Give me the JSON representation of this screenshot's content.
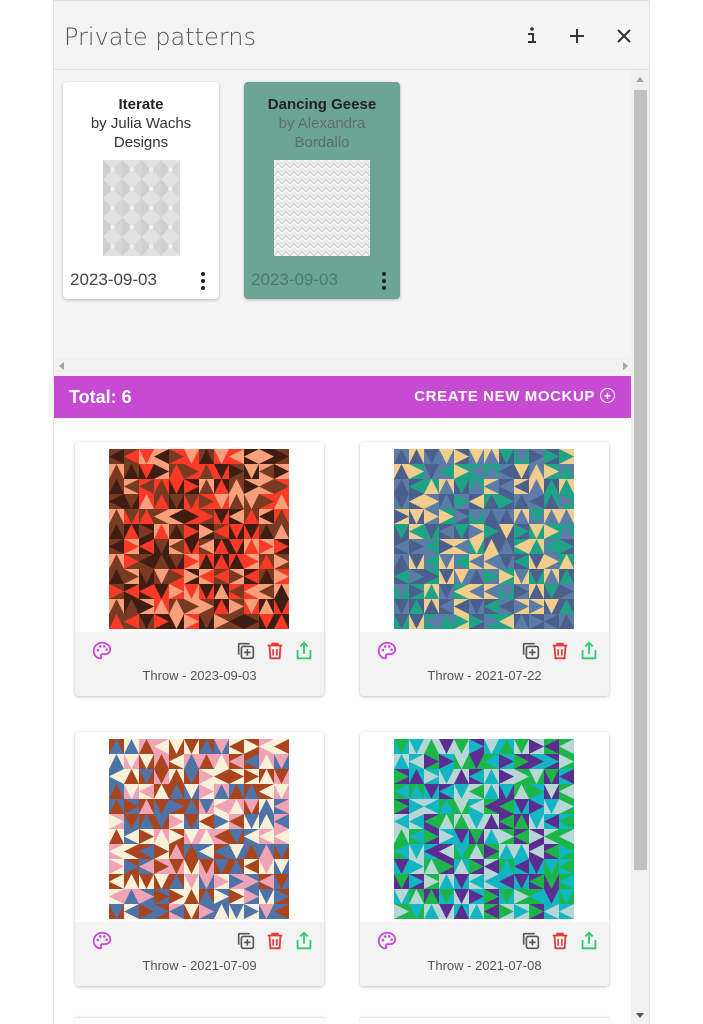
{
  "panel": {
    "title": "Private patterns",
    "info_icon": "info-icon",
    "add_icon": "plus-icon",
    "close_icon": "close-icon"
  },
  "patterns": [
    {
      "name": "Iterate",
      "author": "by Julia Wachs Designs",
      "date": "2023-09-03",
      "selected": false
    },
    {
      "name": "Dancing Geese",
      "author": "by Alexandra Bordallo",
      "date": "2023-09-03",
      "selected": true
    }
  ],
  "mockup_bar": {
    "total_label": "Total: 6",
    "create_label": "CREATE NEW MOCKUP",
    "color": "#c74bd2"
  },
  "mockups": [
    {
      "label": "Throw - 2023-09-03",
      "palette": [
        "#fa3a27",
        "#f8a07c",
        "#7a3a22",
        "#3f1d12"
      ]
    },
    {
      "label": "Throw - 2021-07-22",
      "palette": [
        "#1fa387",
        "#f2cd8c",
        "#5a7ca6",
        "#4b5f8c"
      ]
    },
    {
      "label": "Throw - 2021-07-09",
      "palette": [
        "#f7f1d9",
        "#a9441c",
        "#4e73a8",
        "#f0a3b5"
      ]
    },
    {
      "label": "Throw - 2021-07-08",
      "palette": [
        "#b8d6d6",
        "#12b5c2",
        "#5b2d91",
        "#1bb548"
      ]
    }
  ],
  "icons": {
    "palette": "palette-icon",
    "duplicate": "duplicate-icon",
    "delete": "trash-icon",
    "share": "share-icon"
  },
  "colors": {
    "accent": "#c74bd2",
    "selected_card": "#6da594",
    "delete": "#e53935",
    "share": "#2ecc71"
  }
}
